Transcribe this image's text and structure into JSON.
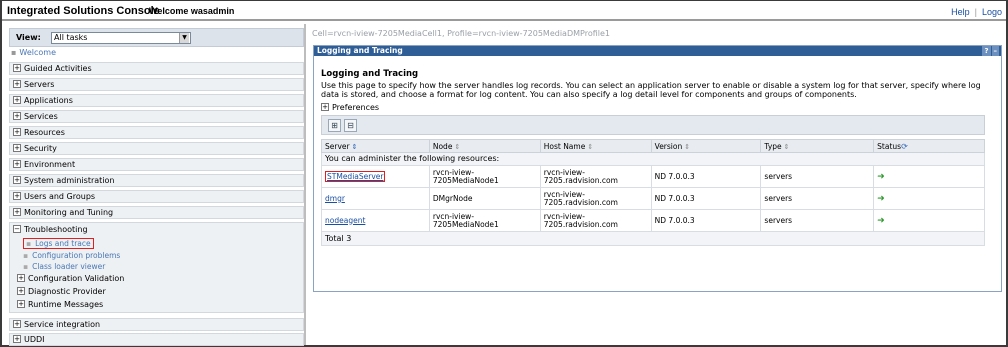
{
  "header": {
    "title": "Integrated Solutions Console",
    "welcome": "Welcome wasadmin",
    "links": [
      "Help",
      "Logo"
    ]
  },
  "nav": {
    "view_label": "View:",
    "view_value": "All tasks",
    "welcome": "Welcome",
    "items": [
      "Guided Activities",
      "Servers",
      "Applications",
      "Services",
      "Resources",
      "Security",
      "Environment",
      "System administration",
      "Users and Groups",
      "Monitoring and Tuning"
    ],
    "troubleshooting": {
      "label": "Troubleshooting",
      "links": [
        "Logs and trace",
        "Configuration problems",
        "Class loader viewer"
      ],
      "subitems": [
        "Configuration Validation",
        "Diagnostic Provider",
        "Runtime Messages"
      ]
    },
    "bottom_items": [
      "Service integration",
      "UDDI"
    ]
  },
  "main": {
    "cell_path": "Cell=rvcn-iview-7205MediaCell1, Profile=rvcn-iview-7205MediaDMProfile1",
    "portlet_title": "Logging and Tracing",
    "portlet_icons": [
      "?",
      "–"
    ],
    "section_title": "Logging and Tracing",
    "description": "Use this page to specify how the server handles log records. You can select an application server to enable or disable a system log for that server, specify where log data is stored, and choose a format for log content. You can also specify a log detail level for components and groups of components.",
    "preferences": "Preferences",
    "table": {
      "headers": [
        "Server",
        "Node",
        "Host Name",
        "Version",
        "Type",
        "Status"
      ],
      "admin_row": "You can administer the following resources:",
      "rows": [
        {
          "server": "STMediaServer",
          "node": "rvcn-iview-7205MediaNode1",
          "host": "rvcn-iview-7205.radvision.com",
          "version": "ND 7.0.0.3",
          "type": "servers"
        },
        {
          "server": "dmgr",
          "node": "DMgrNode",
          "host": "rvcn-iview-7205.radvision.com",
          "version": "ND 7.0.0.3",
          "type": "servers"
        },
        {
          "server": "nodeagent",
          "node": "rvcn-iview-7205MediaNode1",
          "host": "rvcn-iview-7205.radvision.com",
          "version": "ND 7.0.0.3",
          "type": "servers"
        }
      ],
      "total": "Total 3"
    }
  }
}
